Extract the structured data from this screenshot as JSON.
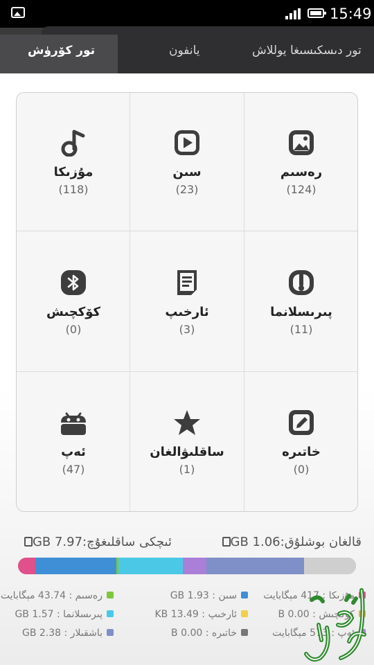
{
  "status_bar": {
    "time": "15:49"
  },
  "tabs": [
    {
      "label": "تور كۆرۈش"
    },
    {
      "label": "يانفون"
    },
    {
      "label": "تور دىسكىسىغا يوللاش"
    }
  ],
  "categories": [
    {
      "label": "مۇزىكا",
      "count": "(118)",
      "icon": "music-note-icon"
    },
    {
      "label": "سىن",
      "count": "(23)",
      "icon": "play-icon"
    },
    {
      "label": "رەسىم",
      "count": "(124)",
      "icon": "image-icon"
    },
    {
      "label": "كۆكچىش",
      "count": "(0)",
      "icon": "bluetooth-icon"
    },
    {
      "label": "ئارخىپ",
      "count": "(3)",
      "icon": "document-icon"
    },
    {
      "label": "پىرىسلانما",
      "count": "(11)",
      "icon": "zip-icon"
    },
    {
      "label": "ئەپ",
      "count": "(47)",
      "icon": "android-icon"
    },
    {
      "label": "ساقلىۋالغان",
      "count": "(1)",
      "icon": "star-icon"
    },
    {
      "label": "خاتىرە",
      "count": "(0)",
      "icon": "note-icon"
    }
  ],
  "storage": {
    "used": "قالغان بوشلۇق:GB 1.06",
    "total": "ئىچكى ساقلىغۇچ:GB 7.97"
  },
  "usage_bar": {
    "segments": [
      {
        "name": "music",
        "color": "#e0508a",
        "fraction": 0.052
      },
      {
        "name": "video",
        "color": "#3f8fd6",
        "fraction": 0.24
      },
      {
        "name": "images",
        "color": "#7fc63a",
        "fraction": 0.005
      },
      {
        "name": "documents",
        "color": "#4ac8e6",
        "fraction": 0.19
      },
      {
        "name": "apps",
        "color": "#a97fd8",
        "fraction": 0.07
      },
      {
        "name": "other",
        "color": "#7f8fc8",
        "fraction": 0.29
      },
      {
        "name": "free",
        "color": "#cfcfcf",
        "fraction": 0.153
      }
    ]
  },
  "legend": [
    {
      "text": "مۇزىكا : 417 مېگابايت",
      "color": "#e0508a"
    },
    {
      "text": "سىن : GB 1.93",
      "color": "#3f8fd6"
    },
    {
      "text": "رەسىم : 43.74 مېگابايت",
      "color": "#7fc63a"
    },
    {
      "text": "كۆكچىش : B 0.00",
      "color": "#f2a93b"
    },
    {
      "text": "ئارخىپ : KB 13.49",
      "color": "#f0d04a"
    },
    {
      "text": "پىرىسلانما : GB 1.57",
      "color": "#4ac8e6"
    },
    {
      "text": "ئەپ : 573 مېگابايت",
      "color": "#a97fd8"
    },
    {
      "text": "خاتىرە : B 0.00",
      "color": "#777777"
    },
    {
      "text": "باشقىلار : GB 2.38",
      "color": "#7f8fc8"
    }
  ]
}
